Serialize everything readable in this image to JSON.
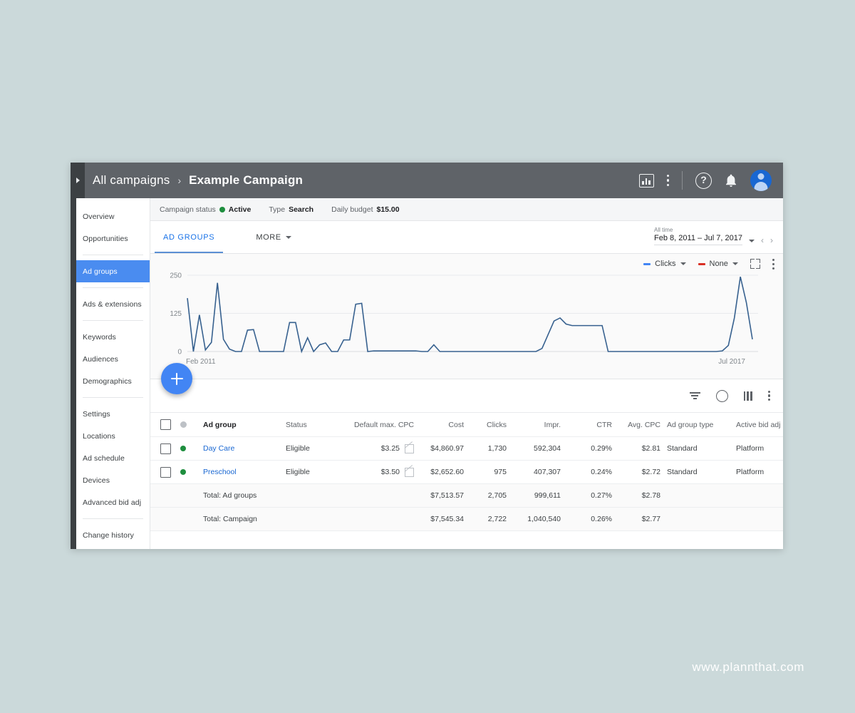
{
  "window": {
    "breadcrumb_root": "All campaigns",
    "breadcrumb_sep": "›",
    "breadcrumb_current": "Example Campaign"
  },
  "topbar": {
    "icons": [
      "reports-icon",
      "kebab-menu-icon",
      "help-icon",
      "notifications-icon",
      "account-avatar"
    ],
    "help_glyph": "?"
  },
  "sidebar": {
    "items": [
      {
        "label": "Overview",
        "active": false
      },
      {
        "label": "Opportunities",
        "active": false
      },
      {
        "label": "Ad groups",
        "active": true
      },
      {
        "label": "Ads & extensions",
        "active": false
      },
      {
        "label": "Keywords",
        "active": false
      },
      {
        "label": "Audiences",
        "active": false
      },
      {
        "label": "Demographics",
        "active": false
      },
      {
        "label": "Settings",
        "active": false
      },
      {
        "label": "Locations",
        "active": false
      },
      {
        "label": "Ad schedule",
        "active": false
      },
      {
        "label": "Devices",
        "active": false
      },
      {
        "label": "Advanced bid adj",
        "active": false
      },
      {
        "label": "Change history",
        "active": false
      }
    ]
  },
  "status_strip": {
    "campaign_status_label": "Campaign status",
    "campaign_status_value": "Active",
    "type_label": "Type",
    "type_value": "Search",
    "budget_label": "Daily budget",
    "budget_value": "$15.00"
  },
  "tabs": {
    "items": [
      {
        "label": "AD GROUPS",
        "active": true
      }
    ],
    "more_label": "MORE"
  },
  "date_range": {
    "label": "All time",
    "value": "Feb 8, 2011 – Jul 7, 2017",
    "prev": "‹",
    "next": "›"
  },
  "chart_controls": {
    "primary_metric": "Clicks",
    "primary_color": "#4285f4",
    "secondary_metric": "None",
    "secondary_color": "#d93025",
    "expand_icon": "expand-icon",
    "menu_icon": "kebab-menu-icon"
  },
  "chart_data": {
    "type": "line",
    "title": "",
    "xlabel": "",
    "ylabel": "Clicks",
    "ylim": [
      0,
      250
    ],
    "yticks": [
      0,
      125,
      250
    ],
    "ytick_labels": [
      "0",
      "125",
      "250"
    ],
    "xtick_labels": [
      "Feb 2011",
      "Jul 2017"
    ],
    "grid": true,
    "legend_position": "top-right",
    "series": [
      {
        "name": "Clicks",
        "color": "#37618f",
        "values": [
          175,
          0,
          120,
          5,
          30,
          225,
          40,
          8,
          0,
          0,
          70,
          72,
          0,
          0,
          0,
          0,
          0,
          95,
          95,
          0,
          45,
          0,
          22,
          28,
          0,
          0,
          38,
          38,
          155,
          158,
          0,
          2,
          2,
          2,
          2,
          2,
          2,
          2,
          2,
          0,
          0,
          22,
          0,
          0,
          0,
          0,
          0,
          0,
          0,
          0,
          0,
          0,
          0,
          0,
          0,
          0,
          0,
          0,
          0,
          10,
          55,
          100,
          110,
          90,
          85,
          85,
          85,
          85,
          85,
          85,
          0,
          0,
          0,
          0,
          0,
          0,
          0,
          0,
          0,
          0,
          0,
          0,
          0,
          0,
          0,
          0,
          0,
          0,
          0,
          2,
          20,
          110,
          245,
          160,
          40
        ]
      }
    ]
  },
  "table_toolbar": {
    "icons": [
      "filter-icon",
      "segment-icon",
      "columns-icon",
      "kebab-menu-icon"
    ]
  },
  "table": {
    "columns": {
      "name": "Ad group",
      "status": "Status",
      "cpc": "Default max. CPC",
      "cost": "Cost",
      "clicks": "Clicks",
      "impr": "Impr.",
      "ctr": "CTR",
      "avgcpc": "Avg. CPC",
      "type": "Ad group type",
      "bid": "Active bid adj"
    },
    "rows": [
      {
        "name": "Day Care",
        "status": "Eligible",
        "cpc": "$3.25",
        "cost": "$4,860.97",
        "clicks": "1,730",
        "impr": "592,304",
        "ctr": "0.29%",
        "avgcpc": "$2.81",
        "type": "Standard",
        "bid": "Platform"
      },
      {
        "name": "Preschool",
        "status": "Eligible",
        "cpc": "$3.50",
        "cost": "$2,652.60",
        "clicks": "975",
        "impr": "407,307",
        "ctr": "0.24%",
        "avgcpc": "$2.72",
        "type": "Standard",
        "bid": "Platform"
      }
    ],
    "totals": [
      {
        "label": "Total: Ad groups",
        "cost": "$7,513.57",
        "clicks": "2,705",
        "impr": "999,611",
        "ctr": "0.27%",
        "avgcpc": "$2.78"
      },
      {
        "label": "Total: Campaign",
        "cost": "$7,545.34",
        "clicks": "2,722",
        "impr": "1,040,540",
        "ctr": "0.26%",
        "avgcpc": "$2.77"
      }
    ]
  },
  "fab": {
    "label": "+"
  },
  "watermark": {
    "text": "www.plannthat.com"
  }
}
